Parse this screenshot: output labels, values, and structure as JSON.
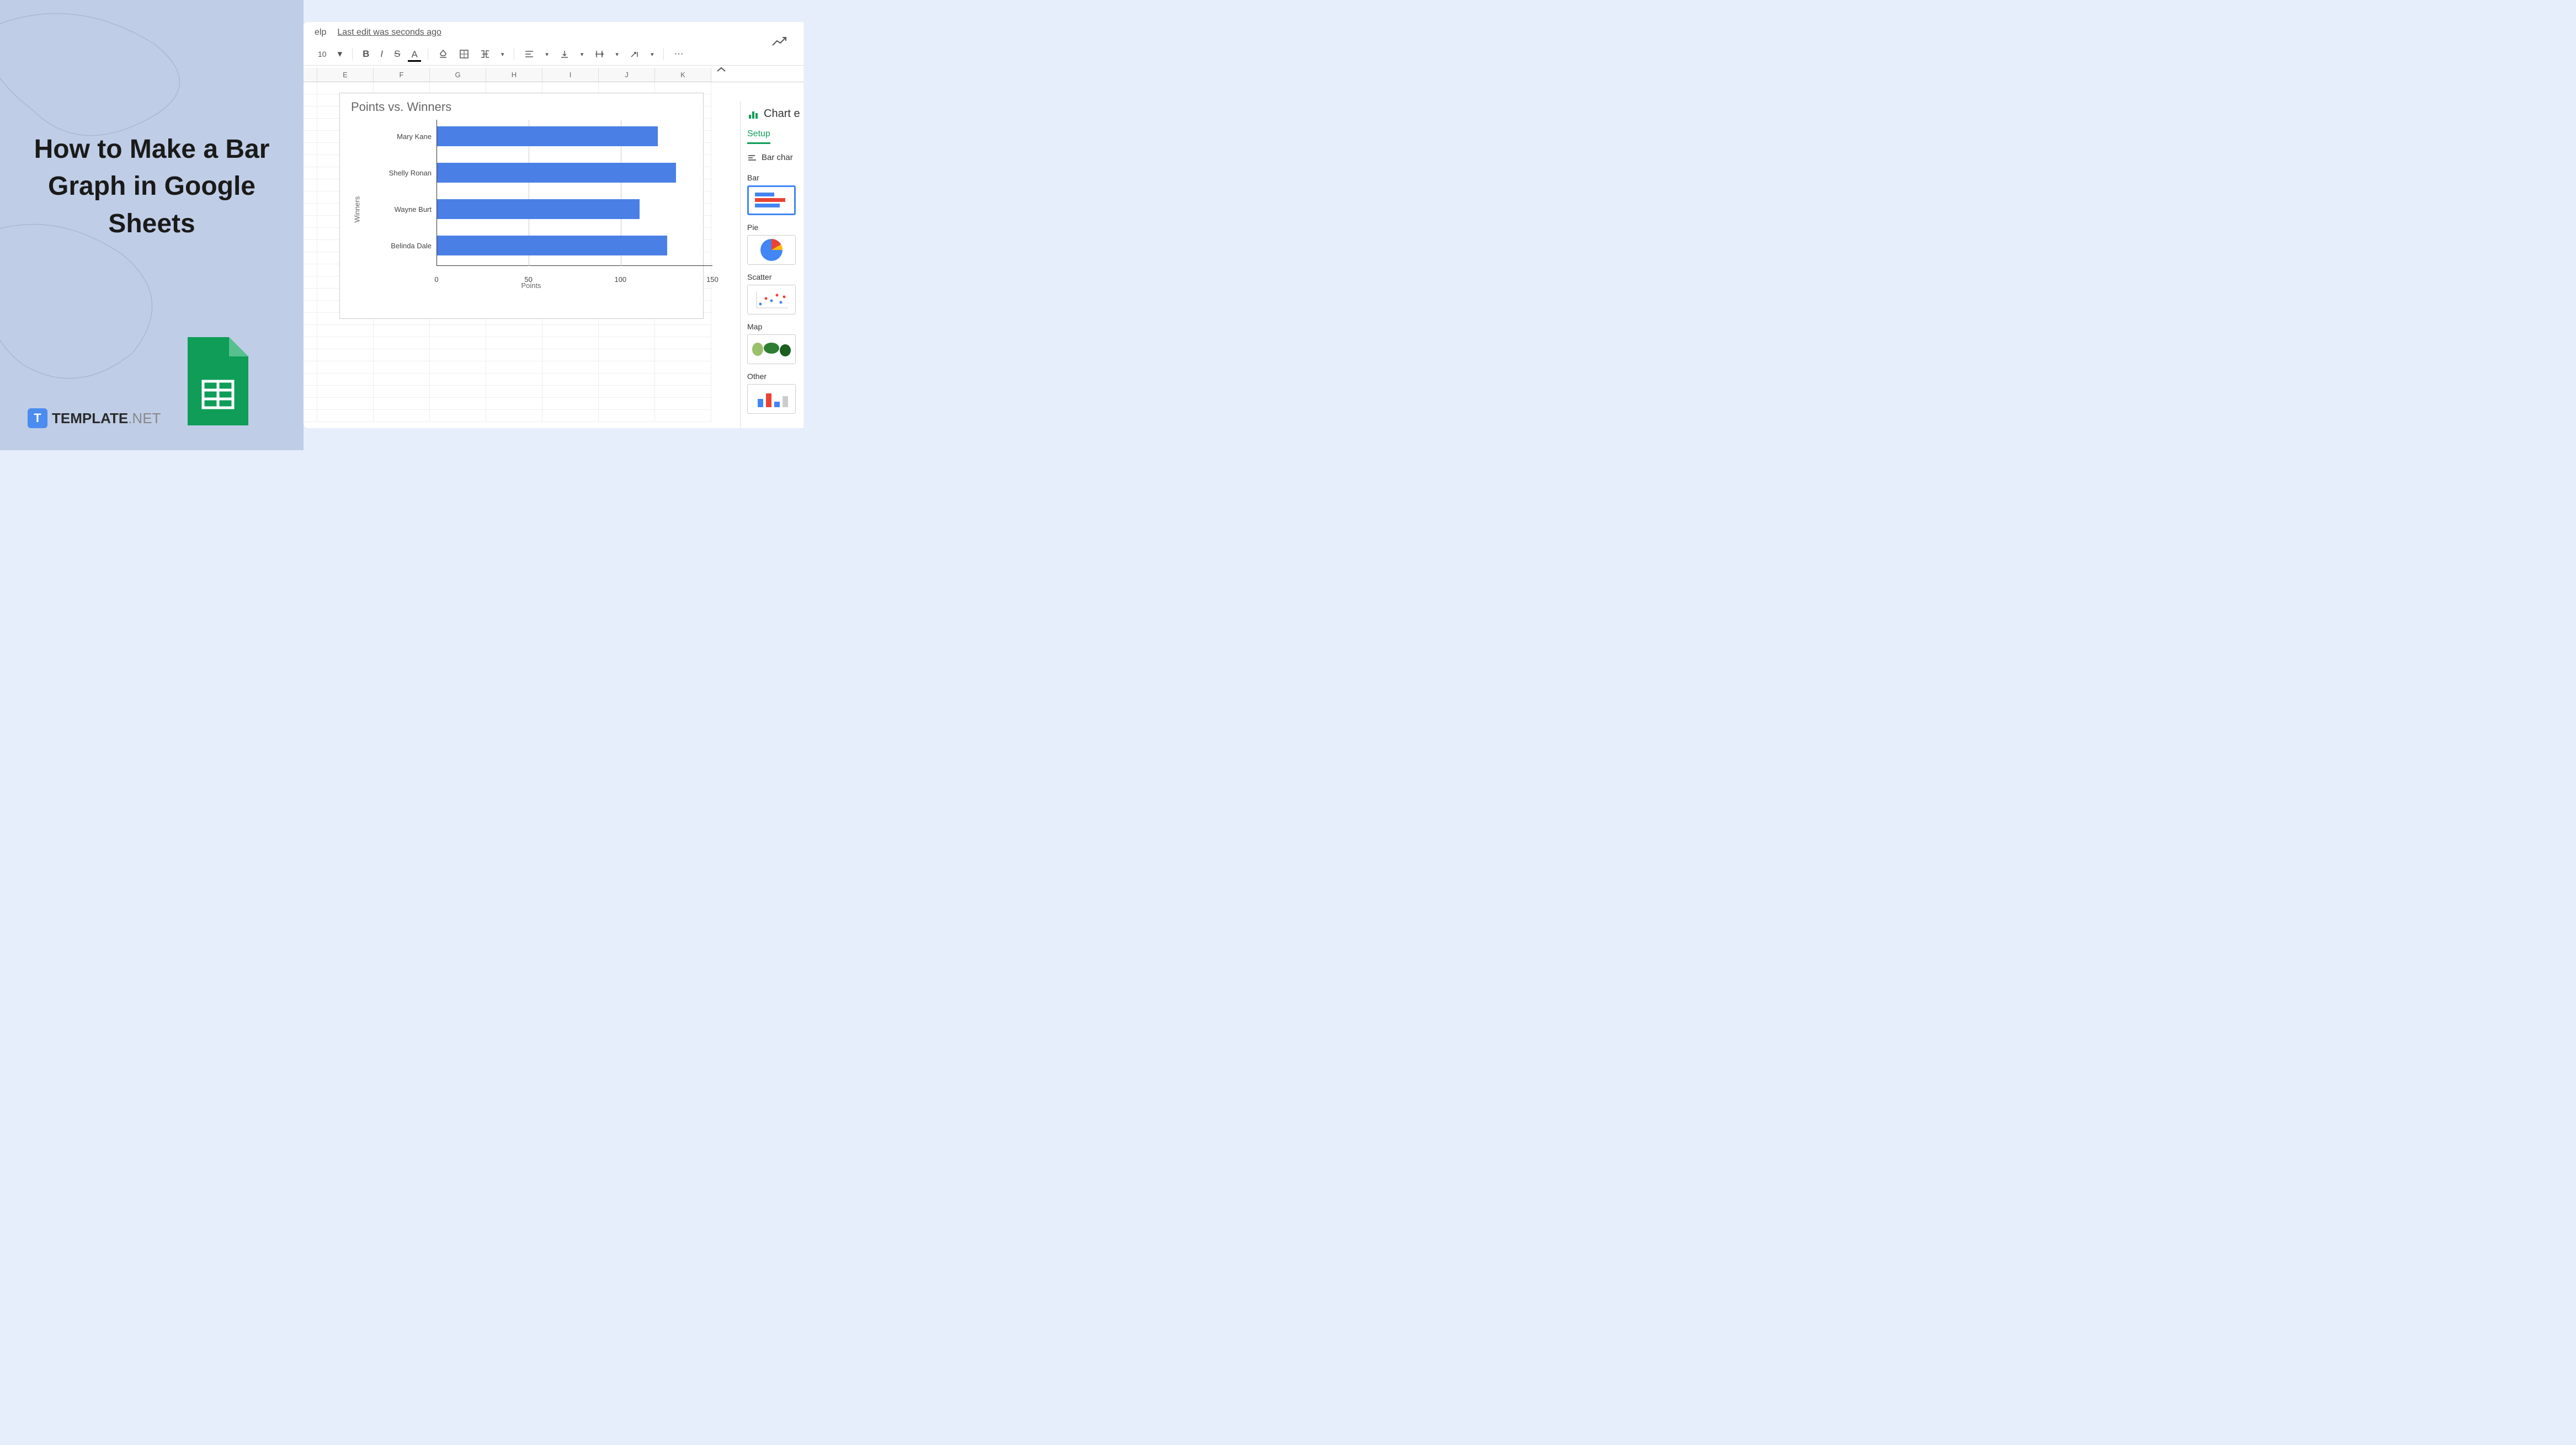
{
  "title": "How to Make a Bar Graph in Google Sheets",
  "branding": {
    "icon_letter": "T",
    "name": "TEMPLATE",
    "suffix": ".NET"
  },
  "menu": {
    "help": "elp",
    "last_edit": "Last edit was seconds ago"
  },
  "toolbar": {
    "font_size": "10",
    "dropdown": "▾"
  },
  "columns": [
    "E",
    "F",
    "G",
    "H",
    "I",
    "J",
    "K"
  ],
  "chart_data": {
    "type": "bar",
    "title": "Points vs. Winners",
    "xlabel": "Points",
    "ylabel": "Winners",
    "categories": [
      "Mary Kane",
      "Shelly Ronan",
      "Wayne Burt",
      "Belinda Dale"
    ],
    "values": [
      120,
      130,
      110,
      125
    ],
    "xlim": [
      0,
      150
    ],
    "xticks": [
      0,
      50,
      100,
      150
    ]
  },
  "editor": {
    "title": "Chart e",
    "tab": "Setup",
    "chart_type_label": "Bar char",
    "categories": {
      "bar": "Bar",
      "pie": "Pie",
      "scatter": "Scatter",
      "map": "Map",
      "other": "Other"
    }
  }
}
